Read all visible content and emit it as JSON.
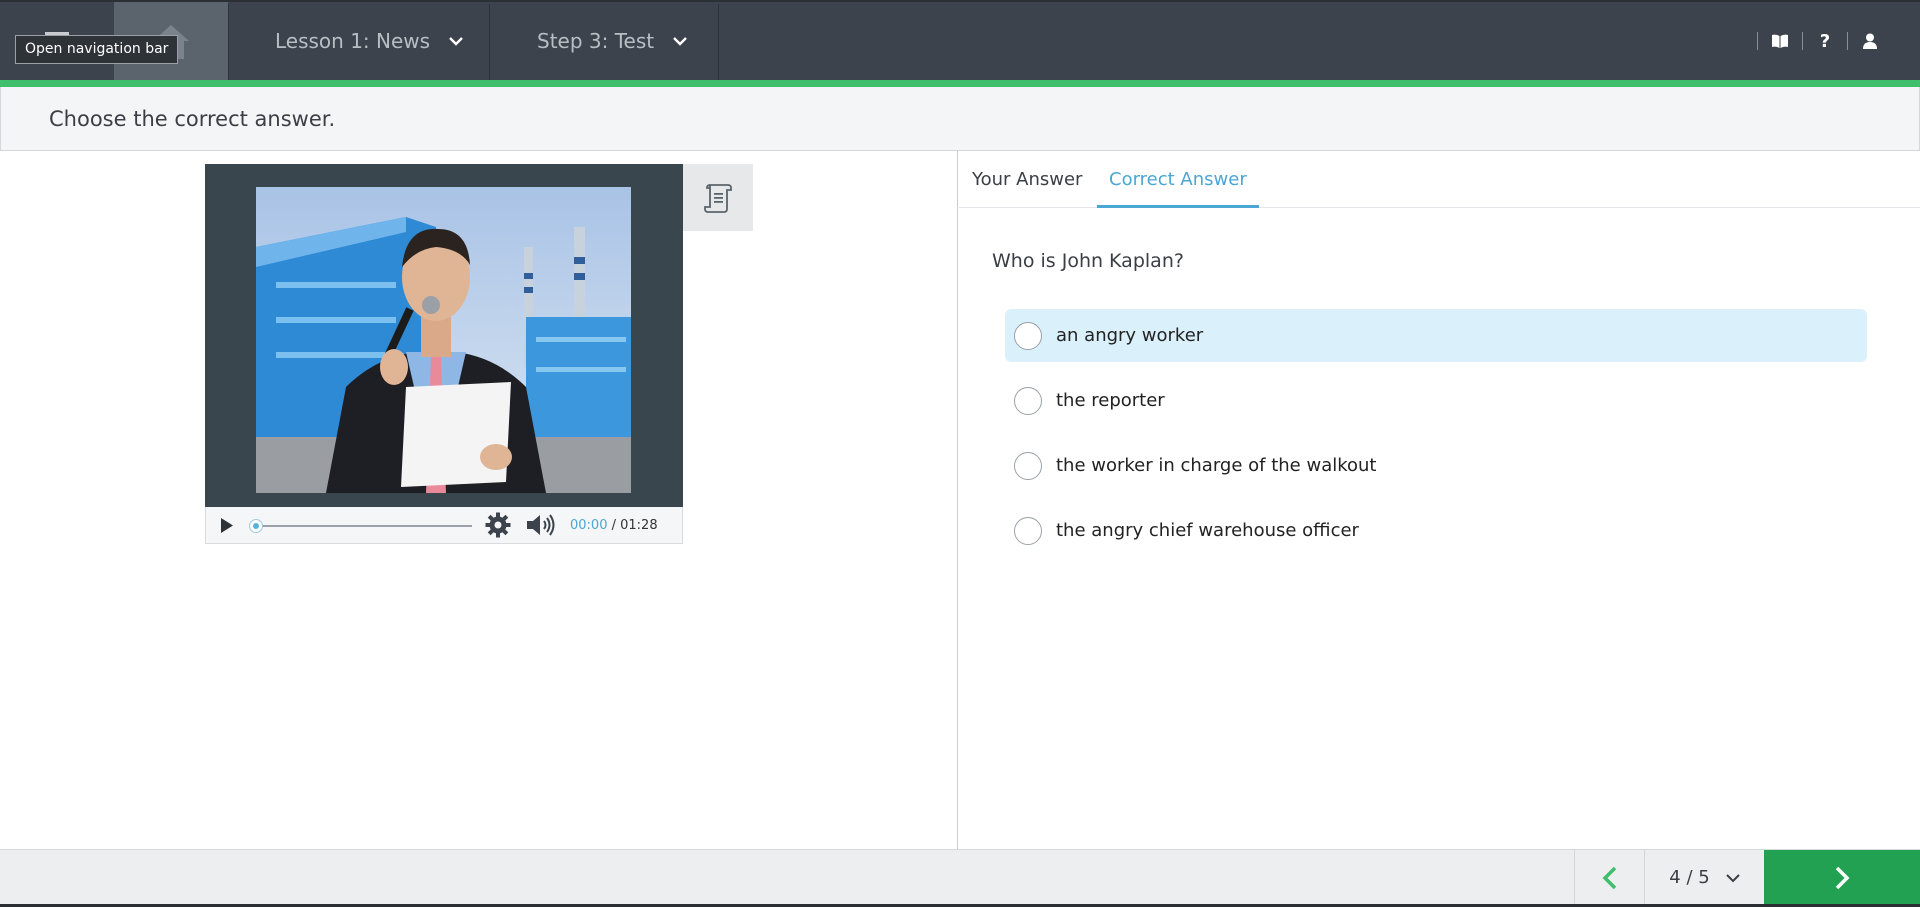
{
  "topbar": {
    "tooltip": "Open navigation bar",
    "lesson_label": "Lesson 1: News",
    "step_label": "Step 3: Test",
    "icons": [
      "menu-icon",
      "home-icon",
      "chevron-down-icon",
      "book-icon",
      "help-icon",
      "user-icon"
    ]
  },
  "instruction": "Choose the correct answer.",
  "player": {
    "current_time": "00:00",
    "duration": "/ 01:28",
    "progress": 0.0,
    "icons": [
      "play-icon",
      "settings-icon",
      "volume-icon",
      "transcript-icon"
    ]
  },
  "tabs": {
    "your_answer": "Your Answer",
    "correct_answer": "Correct Answer",
    "active": "correct_answer"
  },
  "question": "Who is John Kaplan?",
  "options": [
    {
      "label": "an angry worker",
      "selected": true
    },
    {
      "label": "the reporter",
      "selected": false
    },
    {
      "label": "the worker in charge of the walkout",
      "selected": false
    },
    {
      "label": "the angry chief warehouse officer",
      "selected": false
    }
  ],
  "footer": {
    "pager": "4 / 5"
  },
  "colors": {
    "topbar": "#3c434c",
    "accent_green": "#3fbf6b",
    "next_button": "#23a152",
    "tab_active": "#4aa6d4",
    "option_selected": "#daf1fb"
  }
}
